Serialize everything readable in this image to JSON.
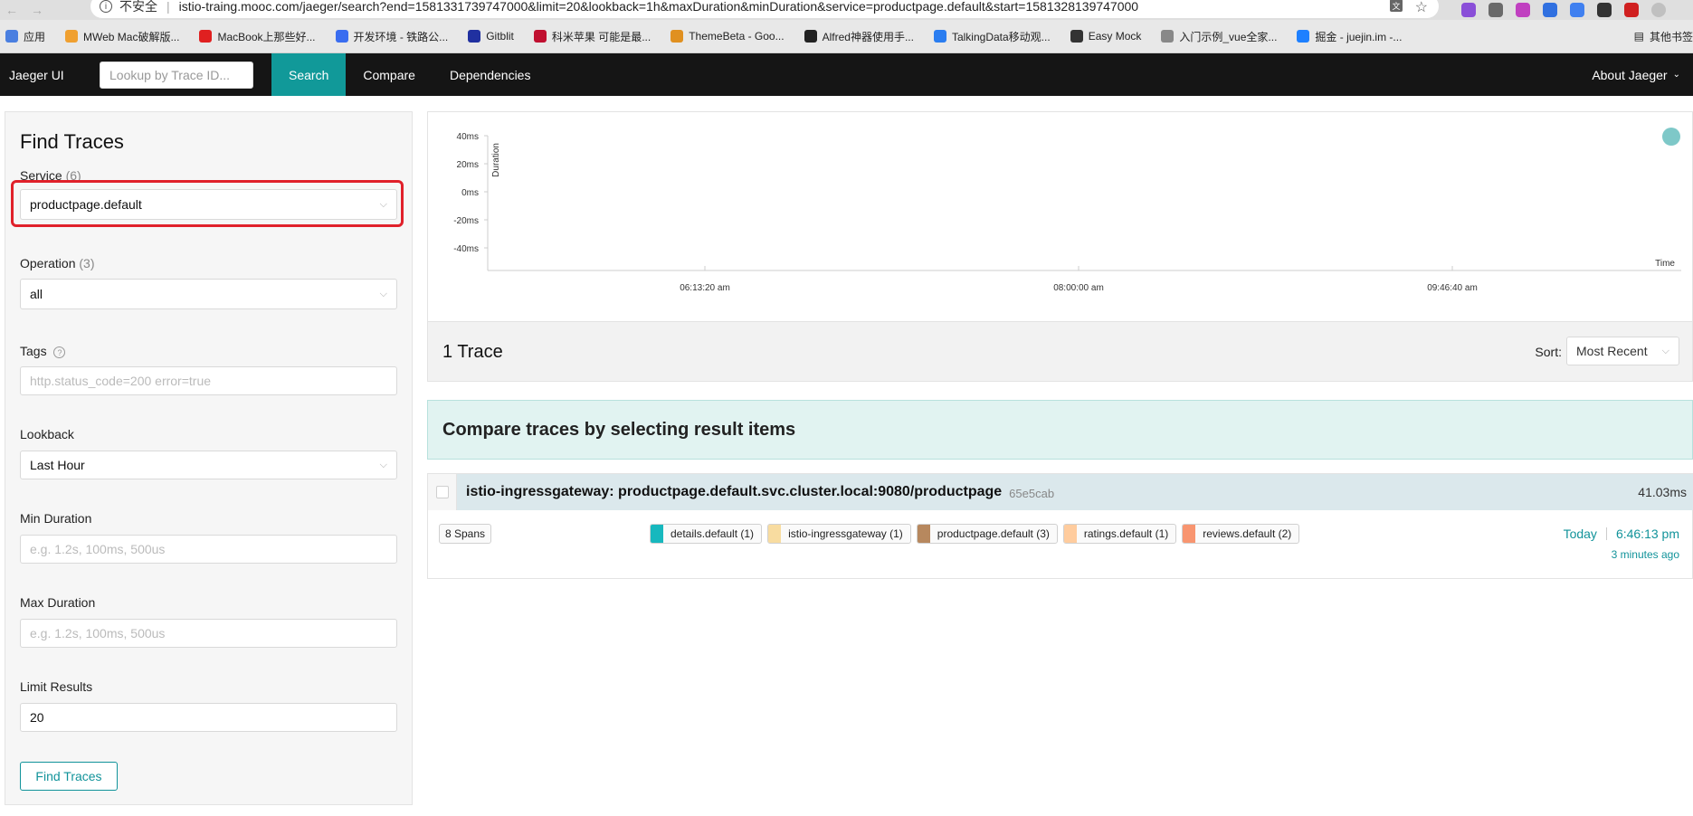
{
  "browser": {
    "insecure_label": "不安全",
    "url": "istio-traing.mooc.com/jaeger/search?end=1581331739747000&limit=20&lookback=1h&maxDuration&minDuration&service=productpage.default&start=1581328139747000",
    "bookmarks": [
      {
        "label": "应用",
        "color": "#4a7fe0"
      },
      {
        "label": "MWeb Mac破解版...",
        "color": "#f0a030"
      },
      {
        "label": "MacBook上那些好...",
        "color": "#e02020"
      },
      {
        "label": "开发环境 - 铁路公...",
        "color": "#3a6df0"
      },
      {
        "label": "Gitblit",
        "color": "#2030a0"
      },
      {
        "label": "科米苹果 可能是最...",
        "color": "#c01030"
      },
      {
        "label": "ThemeBeta - Goo...",
        "color": "#e09020"
      },
      {
        "label": "Alfred神器使用手...",
        "color": "#222222"
      },
      {
        "label": "TalkingData移动观...",
        "color": "#2a7df0"
      },
      {
        "label": "Easy Mock",
        "color": "#333333"
      },
      {
        "label": "入门示例_vue全家...",
        "color": "#888888"
      },
      {
        "label": "掘金 - juejin.im -...",
        "color": "#1e80ff"
      }
    ],
    "other_bookmarks": "其他书签"
  },
  "nav": {
    "brand": "Jaeger UI",
    "lookup_placeholder": "Lookup by Trace ID...",
    "items": [
      "Search",
      "Compare",
      "Dependencies"
    ],
    "about": "About Jaeger"
  },
  "search": {
    "title": "Find Traces",
    "service_label": "Service",
    "service_count": "(6)",
    "service_value": "productpage.default",
    "operation_label": "Operation",
    "operation_count": "(3)",
    "operation_value": "all",
    "tags_label": "Tags",
    "tags_placeholder": "http.status_code=200 error=true",
    "lookback_label": "Lookback",
    "lookback_value": "Last Hour",
    "min_duration_label": "Min Duration",
    "min_duration_placeholder": "e.g. 1.2s, 100ms, 500us",
    "max_duration_label": "Max Duration",
    "max_duration_placeholder": "e.g. 1.2s, 100ms, 500us",
    "limit_label": "Limit Results",
    "limit_value": "20",
    "find_button": "Find Traces"
  },
  "chart_data": {
    "type": "scatter",
    "ylabel": "Duration",
    "xlabel": "Time",
    "y_ticks": [
      "40ms",
      "20ms",
      "0ms",
      "-20ms",
      "-40ms"
    ],
    "x_ticks": [
      "06:13:20 am",
      "08:00:00 am",
      "09:46:40 am"
    ],
    "point_color": "#7ec8c8"
  },
  "results": {
    "count_label": "1 Trace",
    "sort_label": "Sort:",
    "sort_value": "Most Recent",
    "compare_banner": "Compare traces by selecting result items"
  },
  "trace": {
    "title": "istio-ingressgateway: productpage.default.svc.cluster.local:9080/productpage",
    "id": "65e5cab",
    "duration": "41.03ms",
    "spans": "8 Spans",
    "services": [
      {
        "label": "details.default (1)",
        "color": "#17b8be"
      },
      {
        "label": "istio-ingressgateway (1)",
        "color": "#f8dcA0"
      },
      {
        "label": "productpage.default (3)",
        "color": "#b7885e"
      },
      {
        "label": "ratings.default (1)",
        "color": "#ffcc9e"
      },
      {
        "label": "reviews.default (2)",
        "color": "#f89570"
      }
    ],
    "day": "Today",
    "time": "6:46:13 pm",
    "ago": "3 minutes ago"
  }
}
